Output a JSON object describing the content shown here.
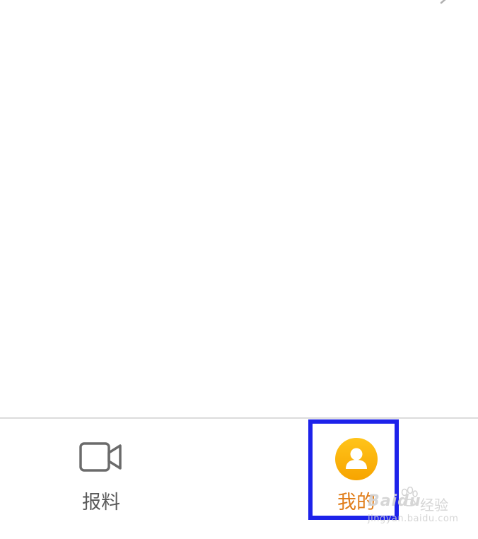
{
  "bottom_nav": {
    "items": [
      {
        "label": "报料",
        "icon": "video-camera-icon",
        "active": false
      },
      {
        "label": "我的",
        "icon": "user-avatar-icon",
        "active": true
      }
    ],
    "active_color": "#e07c18",
    "inactive_color": "#5a5a5a"
  },
  "highlight": {
    "color": "#1d22ea"
  },
  "watermark": {
    "brand": "Baidu",
    "brand_suffix": "经验",
    "url": "jingyan.baidu.com"
  }
}
